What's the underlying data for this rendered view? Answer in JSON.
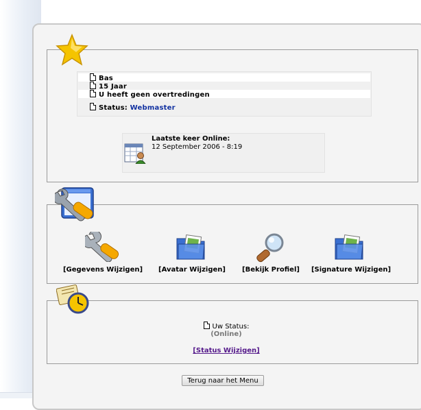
{
  "profile": {
    "name": "Bas",
    "age": "15 Jaar",
    "violations": "U heeft geen overtredingen",
    "status_label": "Status:",
    "status_value": "Webmaster"
  },
  "last_online": {
    "title": "Laatste keer Online:",
    "date": "12 September 2006 - 8:19"
  },
  "actions": [
    {
      "label": "[Gegevens Wijzigen]",
      "icon": "wrench-icon"
    },
    {
      "label": "[Avatar Wijzigen]",
      "icon": "pictures-folder-icon"
    },
    {
      "label": "[Bekijk Profiel]",
      "icon": "magnifier-icon"
    },
    {
      "label": "[Signature Wijzigen]",
      "icon": "pictures-folder-icon"
    }
  ],
  "user_status": {
    "label": "Uw Status:",
    "value": "(Online)",
    "change_link": "[Status Wijzigen]"
  },
  "footer": {
    "menu_button": "Terug naar het Menu"
  },
  "colors": {
    "status_link": "#1030a0",
    "visited_link": "#551a8b",
    "star": "#f5c400"
  }
}
